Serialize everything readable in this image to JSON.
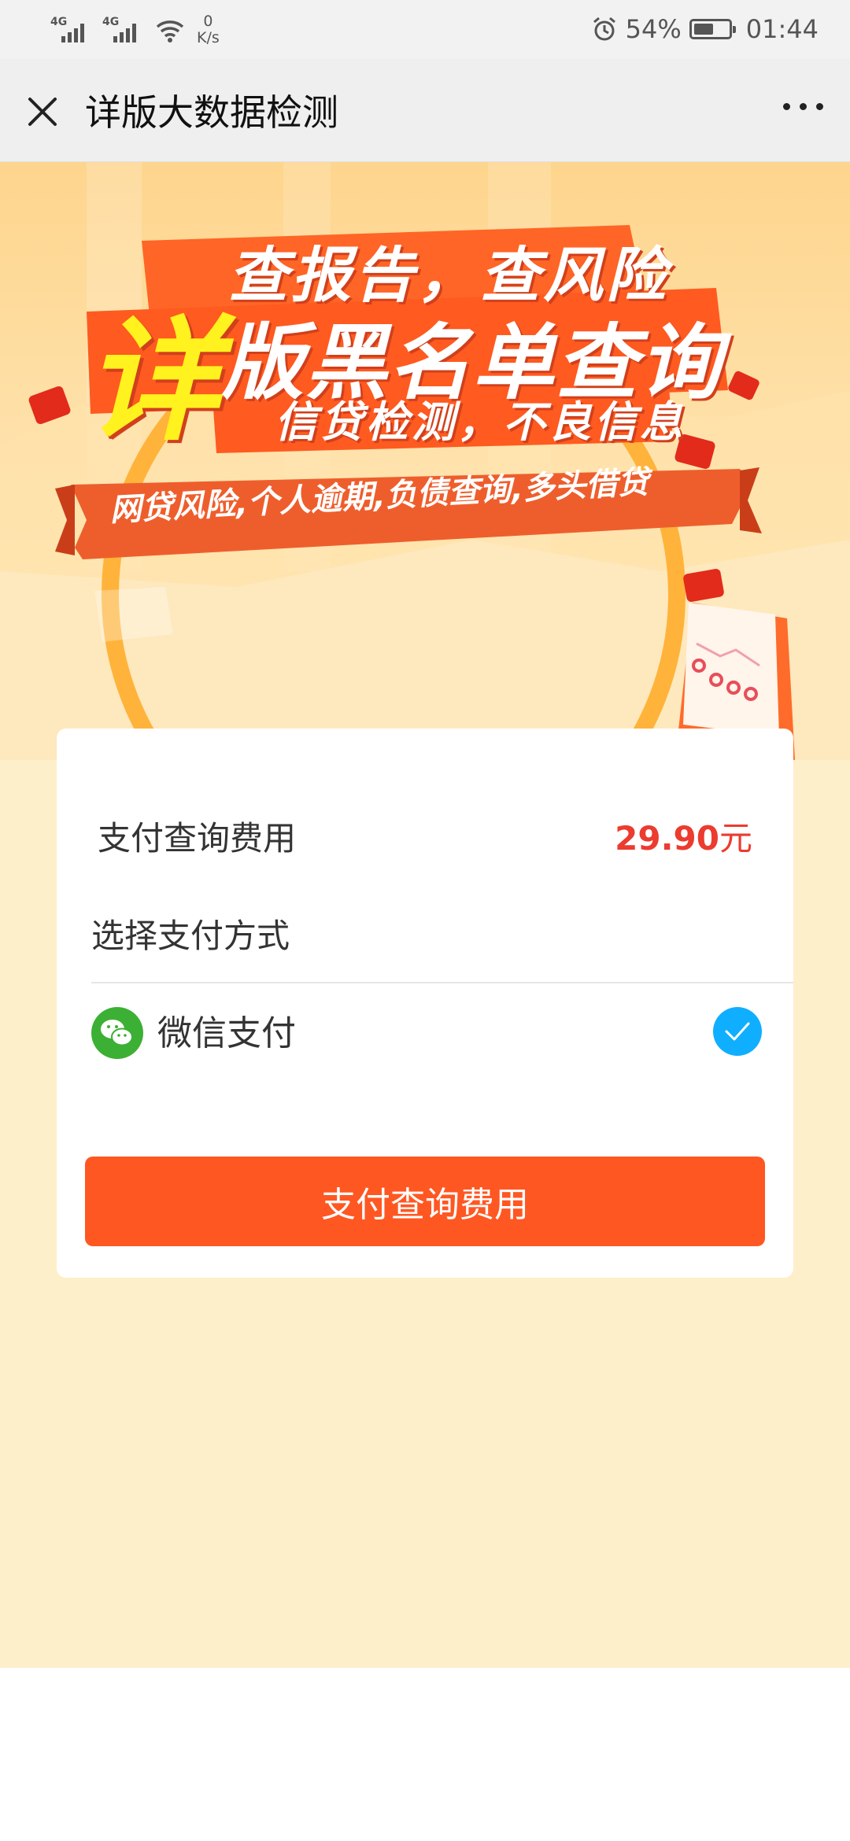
{
  "status_bar": {
    "signal1": "4G",
    "signal2": "4G",
    "speed_value": "0",
    "speed_unit": "K/s",
    "battery_percent": "54%",
    "battery_level": 0.54,
    "time": "01:44"
  },
  "nav": {
    "title": "详版大数据检测",
    "close_icon": "close-icon",
    "more_icon": "more-icon"
  },
  "banner": {
    "line1": "查报告，查风险",
    "big_char": "详",
    "line2": "版黑名单查询",
    "line3": "信贷检测，不良信息",
    "ribbon": "网贷风险,个人逾期,负债查询,多头借贷"
  },
  "payment": {
    "fee_label": "支付查询费用",
    "fee_amount": "29.90",
    "fee_unit": "元",
    "method_label": "选择支付方式",
    "method_name": "微信支付",
    "method_selected": true,
    "button_label": "支付查询费用"
  },
  "colors": {
    "accent": "#ff5722",
    "price": "#ec3b2f",
    "check": "#10aeff",
    "wechat": "#3cb034",
    "page_bg": "#feefcb"
  }
}
